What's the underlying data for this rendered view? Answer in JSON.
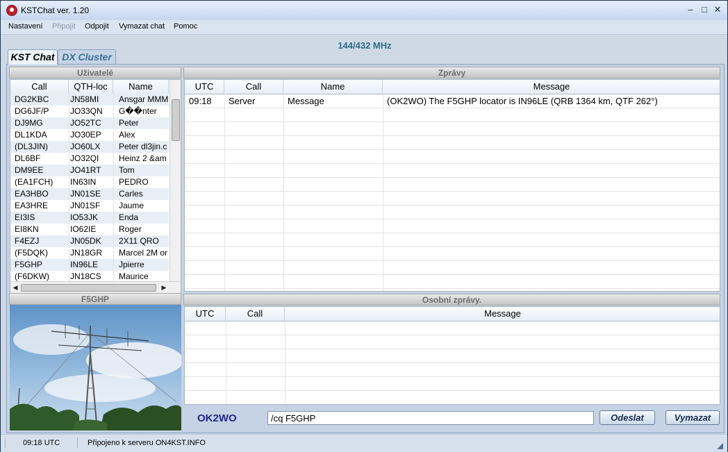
{
  "window": {
    "title": "KSTChat ver. 1.20"
  },
  "menu": [
    {
      "label": "Nastavení",
      "enabled": true
    },
    {
      "label": "Připojit",
      "enabled": false
    },
    {
      "label": "Odpojit",
      "enabled": true
    },
    {
      "label": "Vymazat chat",
      "enabled": true
    },
    {
      "label": "Pomoc",
      "enabled": true
    }
  ],
  "band": "144/432 MHz",
  "tabs": [
    {
      "label": "KST Chat",
      "active": true
    },
    {
      "label": "DX Cluster",
      "active": false
    }
  ],
  "users": {
    "title": "Uživatelé",
    "columns": [
      "Call",
      "QTH-loc",
      "Name"
    ],
    "rows": [
      [
        "DG2KBC",
        "JN58MI",
        "Ansgar MMM"
      ],
      [
        "DG6JF/P",
        "JO33QN",
        "G��nter"
      ],
      [
        "DJ9MG",
        "JO52TC",
        "Peter"
      ],
      [
        "DL1KDA",
        "JO30EP",
        "Alex"
      ],
      [
        "(DL3JIN)",
        "JO60LX",
        "Peter dl3jin.c"
      ],
      [
        "DL6BF",
        "JO32QI",
        "Heinz 2 &am"
      ],
      [
        "DM9EE",
        "JO41RT",
        "Tom"
      ],
      [
        "(EA1FCH)",
        "IN63IN",
        "PEDRO"
      ],
      [
        "EA3HBO",
        "JN01SE",
        "Carles"
      ],
      [
        "EA3HRE",
        "JN01SF",
        "Jaume"
      ],
      [
        "EI3IS",
        "IO53JK",
        "Enda"
      ],
      [
        "EI8KN",
        "IO62IE",
        "Roger"
      ],
      [
        "F4EZJ",
        "JN05DK",
        "2X11 QRO"
      ],
      [
        "(F5DQK)",
        "JN18GR",
        "Marcel 2M or"
      ],
      [
        "F5GHP",
        "IN96LE",
        "Jpierre"
      ],
      [
        "(F6DKW)",
        "JN18CS",
        "Maurice"
      ]
    ]
  },
  "selected_station": {
    "title": "F5GHP"
  },
  "messages": {
    "title": "Zprávy",
    "columns": [
      "UTC",
      "Call",
      "Name",
      "Message"
    ],
    "rows": [
      [
        "09:18",
        "Server",
        "Message",
        "(OK2WO) The F5GHP locator is IN96LE (QRB 1364 km, QTF 262°)"
      ]
    ]
  },
  "private": {
    "title": "Osobní zprávy.",
    "columns": [
      "UTC",
      "Call",
      "Message"
    ],
    "rows": []
  },
  "composer": {
    "callsign": "OK2WO",
    "input_value": "/cq F5GHP",
    "send_label": "Odeslat",
    "clear_label": "Vymazat"
  },
  "status": {
    "time": "09:18 UTC",
    "connection": "Připojeno k serveru ON4KST.INFO"
  },
  "colors": {
    "accent_freq": "#2a6e86",
    "callsign": "#25258e",
    "title_red": "#c0202a"
  }
}
